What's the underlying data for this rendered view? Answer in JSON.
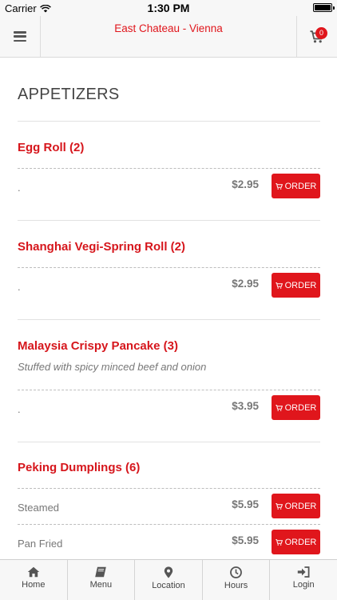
{
  "status_bar": {
    "carrier": "Carrier",
    "time": "1:30 PM"
  },
  "header": {
    "title": "East Chateau - Vienna",
    "cart_count": "0"
  },
  "section": {
    "title": "APPETIZERS"
  },
  "items": [
    {
      "name": "Egg Roll (2)",
      "description": "",
      "options": [
        {
          "label": ".",
          "price": "$2.95",
          "button": "ORDER"
        }
      ]
    },
    {
      "name": "Shanghai Vegi-Spring Roll (2)",
      "description": "",
      "options": [
        {
          "label": ".",
          "price": "$2.95",
          "button": "ORDER"
        }
      ]
    },
    {
      "name": "Malaysia Crispy Pancake (3)",
      "description": "Stuffed with spicy minced beef and onion",
      "options": [
        {
          "label": ".",
          "price": "$3.95",
          "button": "ORDER"
        }
      ]
    },
    {
      "name": "Peking Dumplings (6)",
      "description": "",
      "options": [
        {
          "label": "Steamed",
          "price": "$5.95",
          "button": "ORDER"
        },
        {
          "label": "Pan Fried",
          "price": "$5.95",
          "button": "ORDER"
        }
      ]
    }
  ],
  "tabs": [
    {
      "label": "Home",
      "icon": "home-icon"
    },
    {
      "label": "Menu",
      "icon": "book-icon"
    },
    {
      "label": "Location",
      "icon": "map-pin-icon"
    },
    {
      "label": "Hours",
      "icon": "clock-icon"
    },
    {
      "label": "Login",
      "icon": "sign-in-icon"
    }
  ],
  "colors": {
    "accent": "#e0161c",
    "header_bg": "#f7f7f7"
  }
}
